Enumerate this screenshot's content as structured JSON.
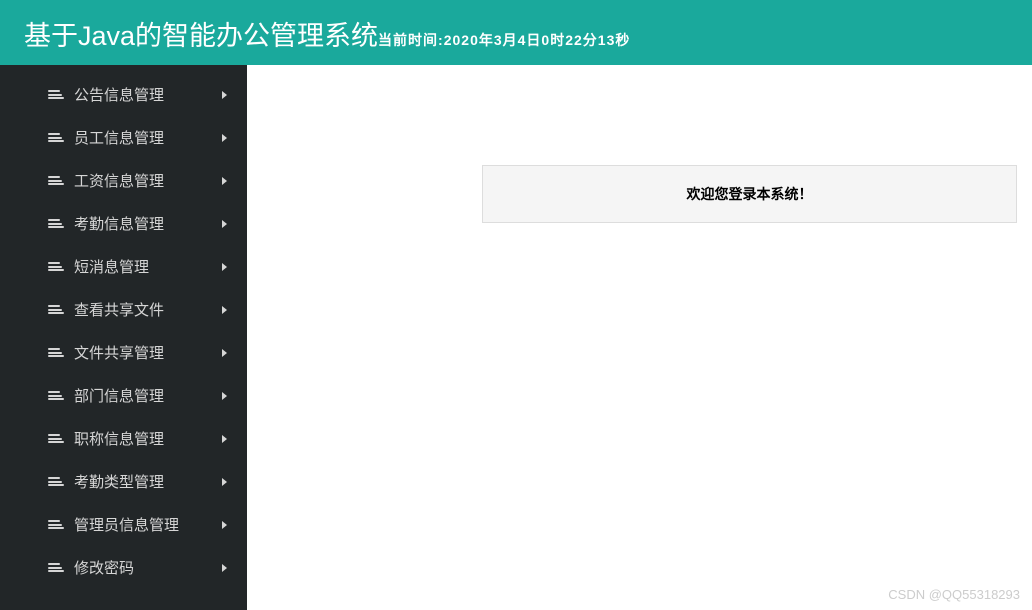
{
  "header": {
    "title": "基于Java的智能办公管理系统",
    "time_label": "当前时间:2020年3月4日0时22分13秒"
  },
  "sidebar": {
    "items": [
      {
        "label": "公告信息管理"
      },
      {
        "label": "员工信息管理"
      },
      {
        "label": "工资信息管理"
      },
      {
        "label": "考勤信息管理"
      },
      {
        "label": "短消息管理"
      },
      {
        "label": "查看共享文件"
      },
      {
        "label": "文件共享管理"
      },
      {
        "label": "部门信息管理"
      },
      {
        "label": "职称信息管理"
      },
      {
        "label": "考勤类型管理"
      },
      {
        "label": "管理员信息管理"
      },
      {
        "label": "修改密码"
      }
    ]
  },
  "main": {
    "welcome_text": "欢迎您登录本系统！"
  },
  "watermark": "CSDN @QQ55318293"
}
